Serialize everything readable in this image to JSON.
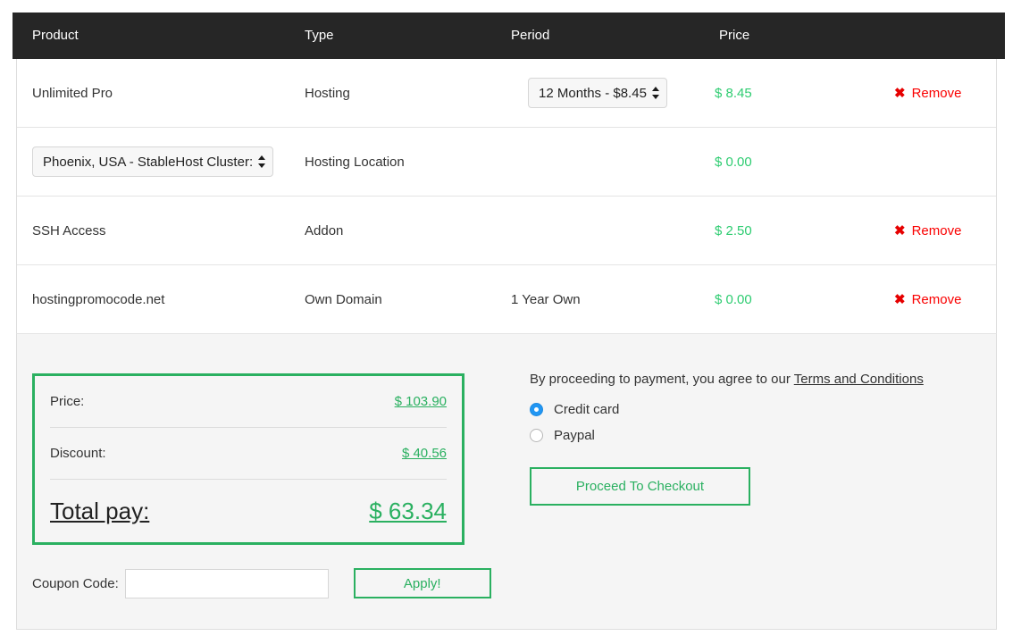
{
  "table": {
    "columns": [
      "Product",
      "Type",
      "Period",
      "Price",
      ""
    ],
    "rows": [
      {
        "product": "Unlimited Pro",
        "type": "Hosting",
        "period_select": "12 Months - $8.45",
        "price": "$ 8.45",
        "remove_label": "Remove",
        "remove_icon": "cross-icon"
      },
      {
        "product_select": "Phoenix, USA - StableHost Cluster:",
        "type": "Hosting Location",
        "period": "",
        "price": "$ 0.00",
        "remove_label": ""
      },
      {
        "product": "SSH Access",
        "type": "Addon",
        "period": "",
        "price": "$ 2.50",
        "remove_label": "Remove",
        "remove_icon": "cross-icon"
      },
      {
        "product": "hostingpromocode.net",
        "type": "Own Domain",
        "period": "1 Year Own",
        "price": "$ 0.00",
        "remove_label": "Remove",
        "remove_icon": "cross-icon"
      }
    ]
  },
  "summary": {
    "price_label": "Price:",
    "price_value": "$ 103.90",
    "discount_label": "Discount:",
    "discount_value": "$ 40.56",
    "total_label": "Total pay:",
    "total_value": "$ 63.34"
  },
  "coupon": {
    "label": "Coupon Code:",
    "value": "",
    "placeholder": "",
    "apply_label": "Apply!"
  },
  "payment": {
    "terms_prefix": "By proceeding to payment, you agree to our ",
    "terms_link": "Terms and Conditions",
    "options": [
      {
        "label": "Credit card",
        "selected": true
      },
      {
        "label": "Paypal",
        "selected": false
      }
    ],
    "checkout_label": "Proceed To Checkout"
  },
  "colors": {
    "header_bg": "#262626",
    "accent_green": "#2ab060",
    "price_green": "#2ecc71",
    "remove_red": "#fa0000",
    "radio_blue": "#2196f3",
    "panel_bg": "#f5f5f5"
  }
}
